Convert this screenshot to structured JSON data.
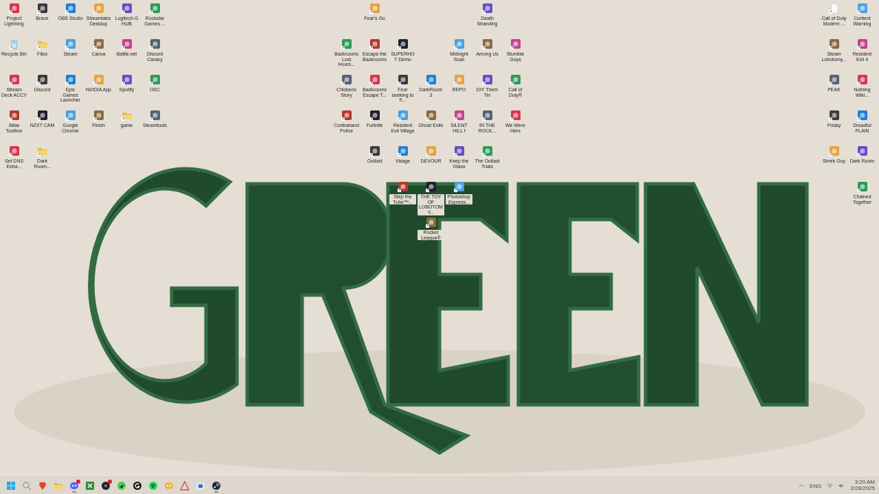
{
  "desktop": {
    "left_icons": [
      {
        "label": "Project Lightning",
        "kind": "app"
      },
      {
        "label": "Brave",
        "kind": "app"
      },
      {
        "label": "OBS Studio",
        "kind": "app"
      },
      {
        "label": "Streamlabs Desktop",
        "kind": "app"
      },
      {
        "label": "Logitech G HUB",
        "kind": "app"
      },
      {
        "label": "Rockstar Games ...",
        "kind": "app"
      },
      {
        "label": "Recycle Bin",
        "kind": "recycle"
      },
      {
        "label": "Files",
        "kind": "folder"
      },
      {
        "label": "Steam",
        "kind": "app"
      },
      {
        "label": "Canva",
        "kind": "app"
      },
      {
        "label": "Battle.net",
        "kind": "app"
      },
      {
        "label": "Discord Canary",
        "kind": "app"
      },
      {
        "label": "Stream Deck ACCY",
        "kind": "app"
      },
      {
        "label": "Discord",
        "kind": "app"
      },
      {
        "label": "Epic Games Launcher",
        "kind": "app"
      },
      {
        "label": "NVIDIA App",
        "kind": "app"
      },
      {
        "label": "Spotify",
        "kind": "app"
      },
      {
        "label": "OSC",
        "kind": "app"
      },
      {
        "label": "Atlas Toolbox",
        "kind": "app"
      },
      {
        "label": "NZXT CAM",
        "kind": "app"
      },
      {
        "label": "Google Chrome",
        "kind": "app"
      },
      {
        "label": "Finish",
        "kind": "app"
      },
      {
        "label": "game",
        "kind": "folder"
      },
      {
        "label": "Steamtools",
        "kind": "app"
      },
      {
        "label": "Set DNS Extra...",
        "kind": "app"
      },
      {
        "label": "Dark Room...",
        "kind": "folder"
      }
    ],
    "center_icons": [
      {
        "label": "Fear's Go",
        "kind": "app"
      },
      {
        "label": "Death Stranding",
        "kind": "app"
      },
      {
        "label": "Backrooms Lost Hours...",
        "kind": "app"
      },
      {
        "label": "Escape the Backrooms",
        "kind": "app"
      },
      {
        "label": "SUPERHOT Demo",
        "kind": "app"
      },
      {
        "label": "Midnight Scan",
        "kind": "app"
      },
      {
        "label": "Among Us",
        "kind": "app"
      },
      {
        "label": "Stumble Guys",
        "kind": "app"
      },
      {
        "label": "Chickens Story",
        "kind": "app"
      },
      {
        "label": "Backrooms Escape T...",
        "kind": "app"
      },
      {
        "label": "Fear seeking to fi...",
        "kind": "app"
      },
      {
        "label": "DarkRoom3",
        "kind": "app"
      },
      {
        "label": "REPO",
        "kind": "app"
      },
      {
        "label": "DIY Them Tin",
        "kind": "app"
      },
      {
        "label": "Call of Duty®",
        "kind": "app"
      },
      {
        "label": "Contraband Police",
        "kind": "app"
      },
      {
        "label": "Fortnite",
        "kind": "app"
      },
      {
        "label": "Resident Evil Village",
        "kind": "app"
      },
      {
        "label": "Ghost Exile",
        "kind": "app"
      },
      {
        "label": "SILENT HILL f",
        "kind": "app"
      },
      {
        "label": "IN THE ROCK...",
        "kind": "app"
      },
      {
        "label": "We Were Here",
        "kind": "app"
      },
      {
        "label": "Outlast",
        "kind": "app"
      },
      {
        "label": "Visage",
        "kind": "app"
      },
      {
        "label": "DEVOUR",
        "kind": "app"
      },
      {
        "label": "Keep the Glass",
        "kind": "app"
      },
      {
        "label": "The Outlast Trials",
        "kind": "app"
      },
      {
        "label": "Step the Tube™...",
        "kind": "app"
      },
      {
        "label": "THE TOY OF LOBOTOMY...",
        "kind": "app"
      },
      {
        "label": "Photoshop Express...",
        "kind": "app"
      },
      {
        "label": "Rocket League®",
        "kind": "app"
      }
    ],
    "right_icons": [
      {
        "label": "Call of Duty Modern ...",
        "kind": "file"
      },
      {
        "label": "Content Warning",
        "kind": "app"
      },
      {
        "label": "Steam Lobotomy...",
        "kind": "app"
      },
      {
        "label": "Resident Evil 4",
        "kind": "app"
      },
      {
        "label": "PEAK",
        "kind": "app"
      },
      {
        "label": "Nothing Wiki...",
        "kind": "app"
      },
      {
        "label": "Friday",
        "kind": "app"
      },
      {
        "label": "Dreadful PLAIN",
        "kind": "app"
      },
      {
        "label": "Shrek Guy",
        "kind": "app"
      },
      {
        "label": "Dark Room",
        "kind": "app"
      },
      {
        "label": "Chained Together",
        "kind": "app"
      }
    ]
  },
  "taskbar": {
    "apps": [
      {
        "kind": "start",
        "running": false,
        "notification": false
      },
      {
        "kind": "search",
        "running": false,
        "notification": false
      },
      {
        "kind": "brave",
        "running": false,
        "notification": false
      },
      {
        "kind": "files",
        "running": false,
        "notification": false
      },
      {
        "kind": "discord",
        "running": true,
        "notification": true
      },
      {
        "kind": "xbox",
        "running": false,
        "notification": false
      },
      {
        "kind": "obs",
        "running": false,
        "notification": true
      },
      {
        "kind": "razer",
        "running": false,
        "notification": false
      },
      {
        "kind": "ghub",
        "running": false,
        "notification": false
      },
      {
        "kind": "spotify",
        "running": false,
        "notification": false
      },
      {
        "kind": "canary",
        "running": false,
        "notification": false
      },
      {
        "kind": "affinity",
        "running": false,
        "notification": false
      },
      {
        "kind": "window",
        "running": false,
        "notification": false
      },
      {
        "kind": "steam",
        "running": true,
        "notification": false
      }
    ],
    "tray": {
      "language": "ENG",
      "time": "3:20 AM",
      "date": "2/28/2025"
    }
  }
}
